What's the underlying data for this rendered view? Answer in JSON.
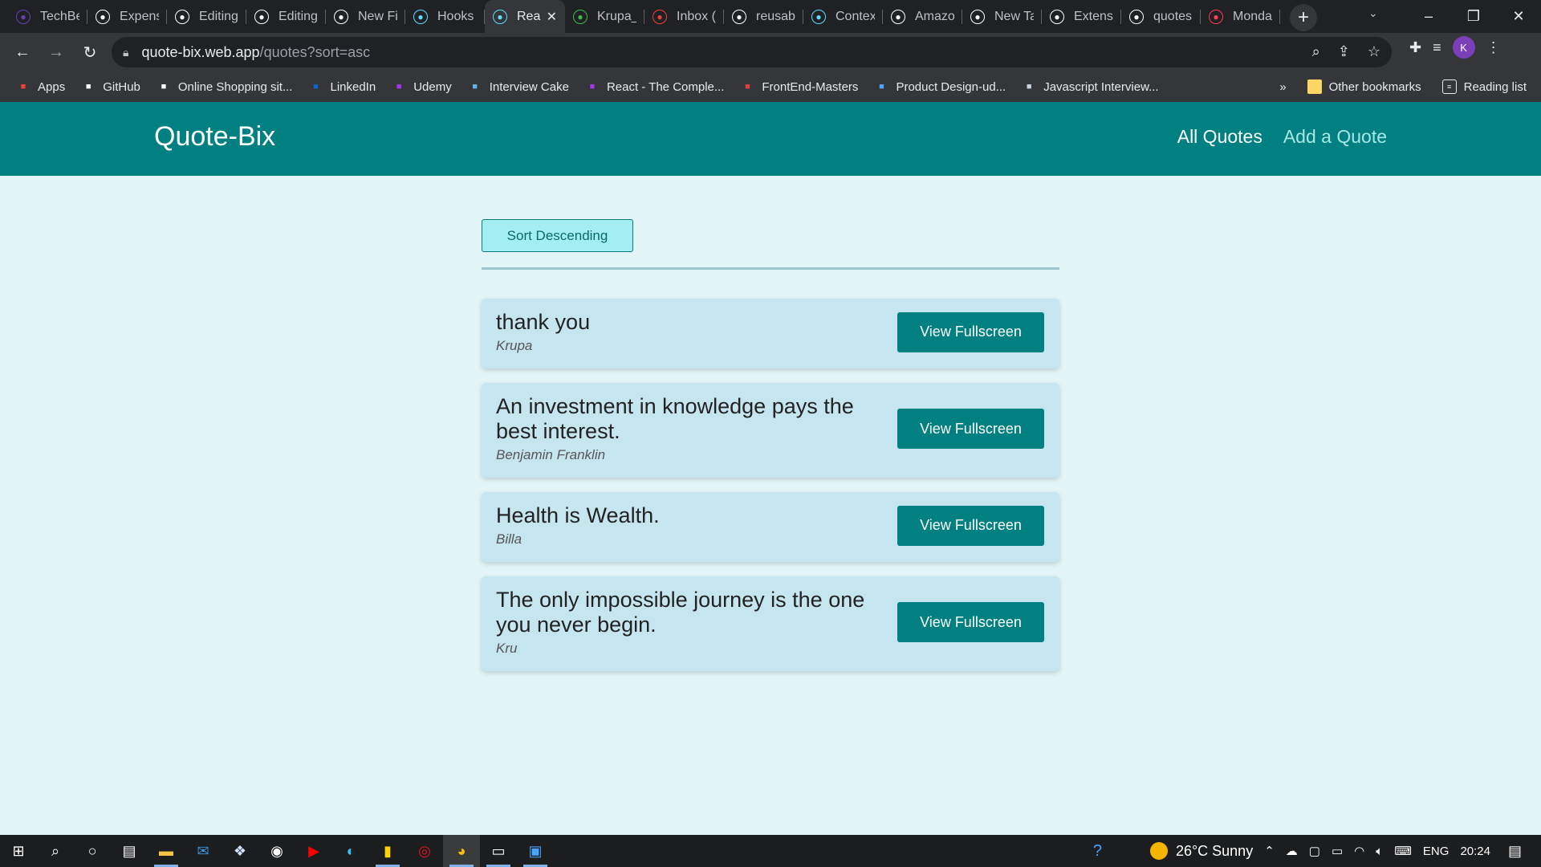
{
  "browser": {
    "tabs": [
      {
        "title": "TechBe",
        "icon": "techbeacon-icon",
        "color": "#6a3fb5"
      },
      {
        "title": "Expens",
        "icon": "github-icon",
        "color": "#ffffff"
      },
      {
        "title": "Editing",
        "icon": "github-icon",
        "color": "#ffffff"
      },
      {
        "title": "Editing",
        "icon": "github-icon",
        "color": "#ffffff"
      },
      {
        "title": "New Fil",
        "icon": "github-icon",
        "color": "#ffffff"
      },
      {
        "title": "Hooks",
        "icon": "react-icon",
        "color": "#61dafb"
      },
      {
        "title": "Rea",
        "icon": "react-icon",
        "color": "#61dafb",
        "active": true
      },
      {
        "title": "Krupa_",
        "icon": "leaf-icon",
        "color": "#3fb950"
      },
      {
        "title": "Inbox (",
        "icon": "gmail-icon",
        "color": "#ea4335"
      },
      {
        "title": "reusabl",
        "icon": "google-icon",
        "color": "#ffffff"
      },
      {
        "title": "Contex",
        "icon": "react-icon",
        "color": "#61dafb"
      },
      {
        "title": "Amazo",
        "icon": "amazon-icon",
        "color": "#ffffff"
      },
      {
        "title": "New Ta",
        "icon": "chrome-icon",
        "color": "#ffffff"
      },
      {
        "title": "Extensi",
        "icon": "puzzle-icon",
        "color": "#ffffff"
      },
      {
        "title": "quotes",
        "icon": "google-icon",
        "color": "#ffffff"
      },
      {
        "title": "Monda",
        "icon": "monday-icon",
        "color": "#ff3d57"
      }
    ],
    "url_host": "quote-bix.web.app",
    "url_path": "/quotes?sort=asc",
    "profile_initial": "K",
    "bookmarks": [
      {
        "label": "Apps",
        "icon": "apps-grid-icon"
      },
      {
        "label": "GitHub",
        "icon": "github-icon"
      },
      {
        "label": "Online Shopping sit...",
        "icon": "amazon-icon"
      },
      {
        "label": "LinkedIn",
        "icon": "linkedin-icon"
      },
      {
        "label": "Udemy",
        "icon": "udemy-icon"
      },
      {
        "label": "Interview Cake",
        "icon": "interview-cake-icon"
      },
      {
        "label": "React - The Comple...",
        "icon": "udemy-icon"
      },
      {
        "label": "FrontEnd-Masters",
        "icon": "frontend-masters-icon"
      },
      {
        "label": "Product Design-ud...",
        "icon": "product-design-icon"
      },
      {
        "label": "Javascript Interview...",
        "icon": "javascript-interview-icon"
      }
    ],
    "bookmarks_overflow": "»",
    "other_bookmarks": "Other bookmarks",
    "reading_list": "Reading list"
  },
  "app": {
    "logo": "Quote-Bix",
    "nav": {
      "all_quotes": "All Quotes",
      "add_quote": "Add a Quote"
    },
    "sort_button": "Sort Descending",
    "view_button_label": "View Fullscreen",
    "quotes": [
      {
        "text": "thank you",
        "author": "Krupa"
      },
      {
        "text": "An investment in knowledge pays the best interest.",
        "author": "Benjamin Franklin"
      },
      {
        "text": "Health is Wealth.",
        "author": "Billa"
      },
      {
        "text": "The only impossible journey is the one you never begin.",
        "author": "Kru"
      }
    ]
  },
  "taskbar": {
    "weather": "26°C  Sunny",
    "language": "ENG",
    "time": "20:24"
  },
  "colors": {
    "header": "#008080",
    "page_bg": "#e2f6f8",
    "card_bg": "#c5e6ee",
    "button": "#008080"
  }
}
